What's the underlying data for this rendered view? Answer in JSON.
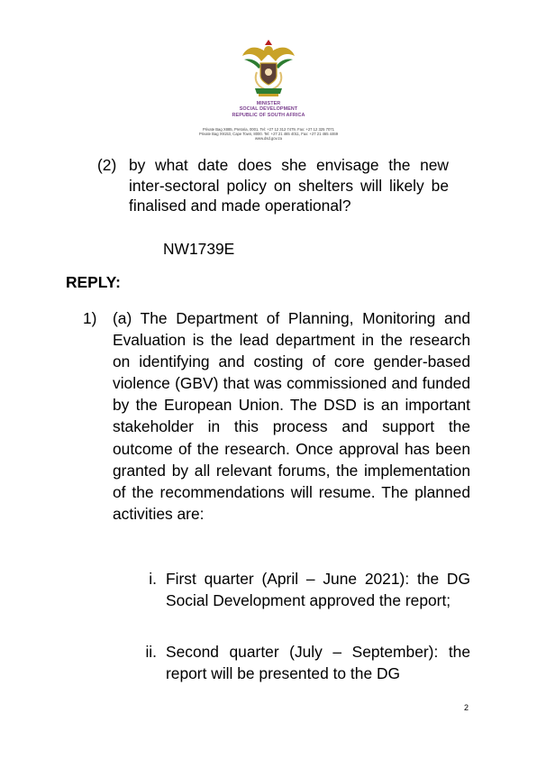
{
  "letterhead": {
    "emblem": "south-africa-coat-of-arms",
    "line1": "MINISTER",
    "line2": "SOCIAL DEVELOPMENT",
    "line3": "REPUBLIC OF SOUTH AFRICA",
    "address1": "Private Bag X885, Pretoria, 0001. Tel: +27 12 312 7479, Fax: +27 12 325 7071",
    "address2": "Private Bag X9153, Cape Town, 8000. Tel: +27 21 465 4011, Fax: +27 21 465 4469",
    "website": "www.dsd.gov.za"
  },
  "question": {
    "number": "(2)",
    "text": "by what date does she envisage the new inter-sectoral policy on shelters will likely be finalised and made operational?",
    "reference": "NW1739E"
  },
  "reply_heading": "REPLY:",
  "reply": {
    "number": "1)",
    "text": "(a) The Department of Planning, Monitoring and Evaluation is the lead department in the research on identifying and costing of core gender-based violence (GBV) that was commissioned and funded by the European Union. The DSD is an important stakeholder in this process and support the outcome of the research. Once approval has been granted by all relevant forums, the implementation of the recommendations will resume. The planned activities are:",
    "activities": [
      {
        "number": "i.",
        "text": "First quarter (April – June 2021): the DG Social Development approved the report;"
      },
      {
        "number": "ii.",
        "text": "Second quarter (July – September): the report will be presented to the DG"
      }
    ]
  },
  "page_number": "2",
  "colors": {
    "letterhead_text": "#7a3e8e",
    "emblem_gold": "#c9a227",
    "emblem_green": "#2e7d32"
  }
}
